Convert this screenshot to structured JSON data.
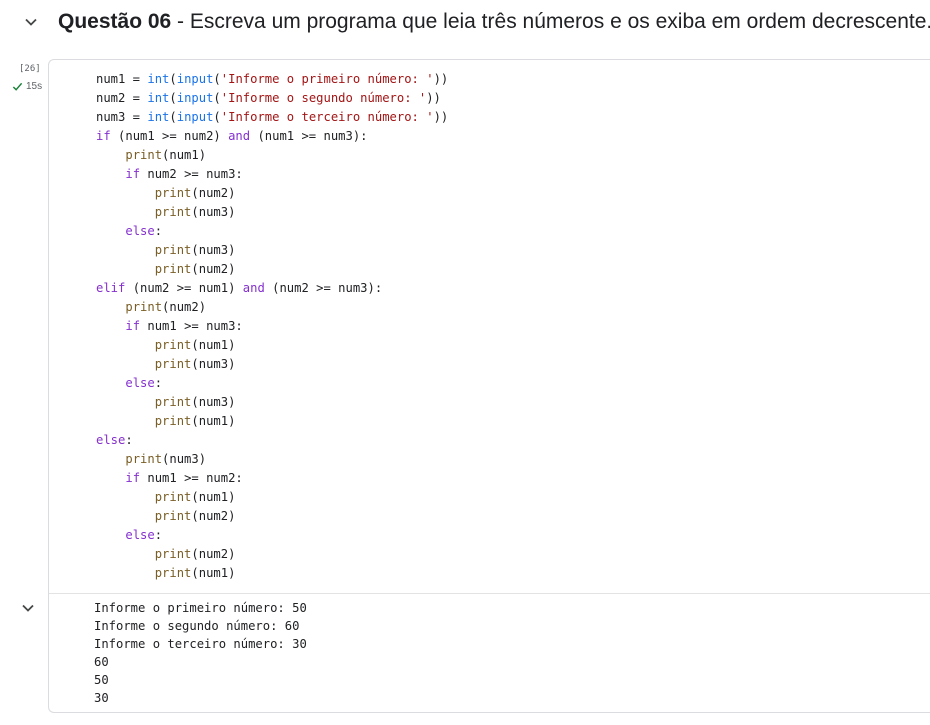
{
  "heading": {
    "bold": "Questão 06",
    "rest": " - Escreva um programa que leia três números e os exiba em ordem decrescente."
  },
  "cell": {
    "exec_count": "[26]",
    "exec_time": "15s",
    "code_lines": [
      "num1 = int(input('Informe o primeiro número: '))",
      "num2 = int(input('Informe o segundo número: '))",
      "num3 = int(input('Informe o terceiro número: '))",
      "if (num1 >= num2) and (num1 >= num3):",
      "    print(num1)",
      "    if num2 >= num3:",
      "        print(num2)",
      "        print(num3)",
      "    else:",
      "        print(num3)",
      "        print(num2)",
      "elif (num2 >= num1) and (num2 >= num3):",
      "    print(num2)",
      "    if num1 >= num3:",
      "        print(num1)",
      "        print(num3)",
      "    else:",
      "        print(num3)",
      "        print(num1)",
      "else:",
      "    print(num3)",
      "    if num1 >= num2:",
      "        print(num1)",
      "        print(num2)",
      "    else:",
      "        print(num2)",
      "        print(num1)"
    ],
    "output_lines": [
      "Informe o primeiro número: 50",
      "Informe o segundo número: 60",
      "Informe o terceiro número: 30",
      "60",
      "50",
      "30"
    ]
  },
  "icons": {
    "section_toggle": "chevron-down-icon",
    "exec_status": "check-icon",
    "output_toggle": "chevron-down-icon"
  },
  "colors": {
    "keyword": "#8430ce",
    "builtin": "#795e26",
    "function": "#1a73e8",
    "string": "#a31515",
    "status_check": "#188038",
    "cell_border": "#dadce0"
  }
}
